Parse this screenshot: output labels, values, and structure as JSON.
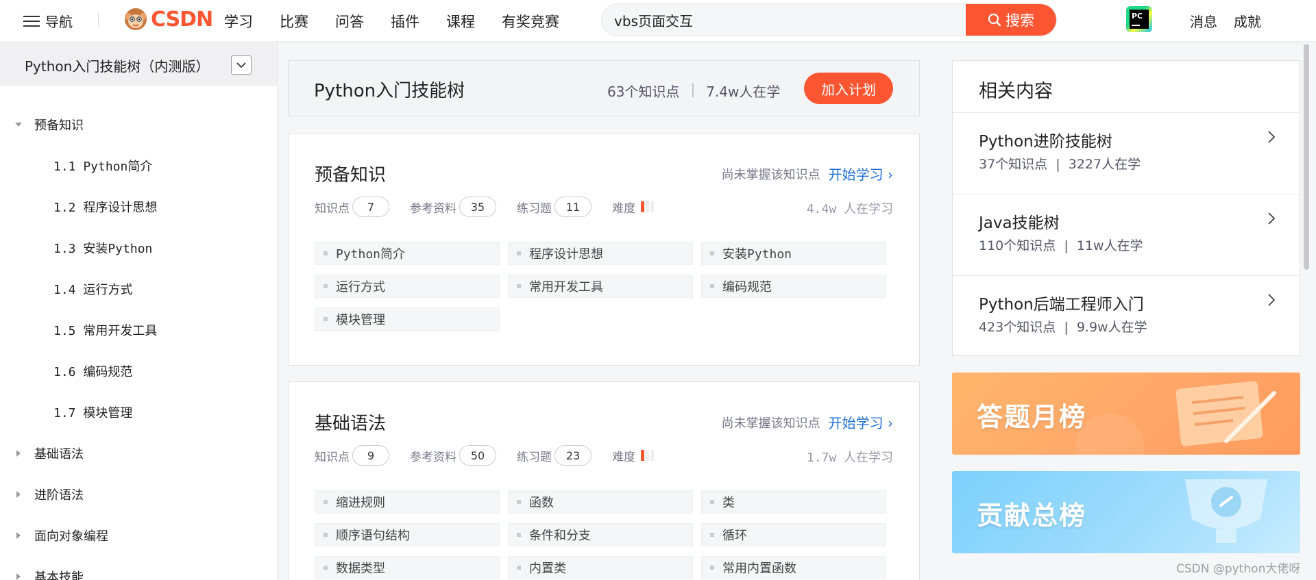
{
  "topbar": {
    "nav_label": "导航",
    "logo_text": "CSDN",
    "nav_items": [
      "学习",
      "比赛",
      "问答",
      "插件",
      "课程",
      "有奖竞赛"
    ],
    "search_value": "vbs页面交互",
    "search_button": "搜索",
    "right_items": [
      "消息",
      "成就"
    ],
    "brand_color": "#fc5531"
  },
  "sidebar": {
    "title": "Python入门技能树（内测版）",
    "tree": [
      {
        "label": "预备知识",
        "expanded": true
      },
      {
        "label": "1.1 Python简介"
      },
      {
        "label": "1.2 程序设计思想"
      },
      {
        "label": "1.3 安装Python"
      },
      {
        "label": "1.4 运行方式"
      },
      {
        "label": "1.5 常用开发工具"
      },
      {
        "label": "1.6 编码规范"
      },
      {
        "label": "1.7 模块管理"
      },
      {
        "label": "基础语法",
        "expanded": false
      },
      {
        "label": "进阶语法",
        "expanded": false
      },
      {
        "label": "面向对象编程",
        "expanded": false
      },
      {
        "label": "基本技能",
        "expanded": false
      }
    ]
  },
  "plan": {
    "title": "Python入门技能树",
    "points": "63个知识点",
    "learners": "7.4w人在学",
    "button": "加入计划"
  },
  "sections": [
    {
      "title": "预备知识",
      "status": "尚未掌握该知识点",
      "action": "开始学习",
      "labels": {
        "points": "知识点",
        "refs": "参考资料",
        "exercises": "练习题",
        "difficulty": "难度"
      },
      "points": "7",
      "refs": "35",
      "exercises": "11",
      "difficulty_level": 1,
      "learners": "4.4w 人在学习",
      "topics": [
        "Python简介",
        "程序设计思想",
        "安装Python",
        "运行方式",
        "常用开发工具",
        "编码规范",
        "模块管理"
      ]
    },
    {
      "title": "基础语法",
      "status": "尚未掌握该知识点",
      "action": "开始学习",
      "labels": {
        "points": "知识点",
        "refs": "参考资料",
        "exercises": "练习题",
        "difficulty": "难度"
      },
      "points": "9",
      "refs": "50",
      "exercises": "23",
      "difficulty_level": 1,
      "learners": "1.7w 人在学习",
      "topics": [
        "缩进规则",
        "函数",
        "类",
        "顺序语句结构",
        "条件和分支",
        "循环",
        "数据类型",
        "内置类",
        "常用内置函数"
      ]
    }
  ],
  "related": {
    "title": "相关内容",
    "items": [
      {
        "title": "Python进阶技能树",
        "points": "37个知识点",
        "learners": "3227人在学"
      },
      {
        "title": "Java技能树",
        "points": "110个知识点",
        "learners": "11w人在学"
      },
      {
        "title": "Python后端工程师入门",
        "points": "423个知识点",
        "learners": "9.9w人在学"
      }
    ]
  },
  "banners": {
    "monthly": "答题月榜",
    "contribution": "贡献总榜"
  },
  "watermark": "CSDN @python大佬呀"
}
